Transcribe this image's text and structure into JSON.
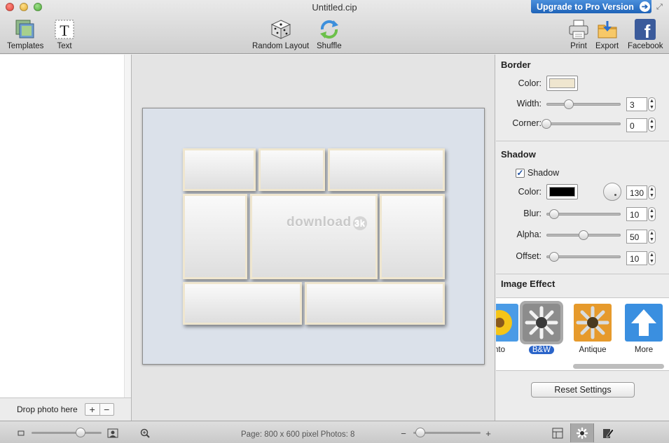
{
  "window": {
    "title": "Untitled.cip",
    "upgrade_label": "Upgrade to Pro Version"
  },
  "toolbar": {
    "templates_label": "Templates",
    "text_label": "Text",
    "random_layout_label": "Random Layout",
    "shuffle_label": "Shuffle",
    "print_label": "Print",
    "export_label": "Export",
    "facebook_label": "Facebook"
  },
  "sidebar": {
    "drop_label": "Drop photo here",
    "add_label": "+",
    "remove_label": "−"
  },
  "canvas": {
    "watermark_text": "download",
    "watermark_badge": "3k",
    "page_color": "#dbe1ea",
    "cell_border_color": "#efe6cf",
    "photo_cells": 8
  },
  "panel": {
    "border": {
      "title": "Border",
      "color_label": "Color:",
      "color_value": "#efe6cf",
      "width_label": "Width:",
      "width_value": "3",
      "width_level": 0.3,
      "corner_label": "Corner:",
      "corner_value": "0",
      "corner_level": 0.0
    },
    "shadow": {
      "title": "Shadow",
      "checkbox_label": "Shadow",
      "checked": true,
      "color_label": "Color:",
      "color_value": "#000000",
      "angle_value": "130",
      "blur_label": "Blur:",
      "blur_value": "10",
      "blur_level": 0.1,
      "alpha_label": "Alpha:",
      "alpha_value": "50",
      "alpha_level": 0.5,
      "offset_label": "Offset:",
      "offset_value": "10",
      "offset_level": 0.1
    },
    "image_effect": {
      "title": "Image Effect",
      "items": [
        {
          "label": "nto",
          "icon": "flower-auto-icon",
          "selected": false
        },
        {
          "label": "B&W",
          "icon": "flower-bw-icon",
          "selected": true
        },
        {
          "label": "Antique",
          "icon": "flower-antique-icon",
          "selected": false
        },
        {
          "label": "More",
          "icon": "arrow-up-icon",
          "selected": false
        }
      ]
    },
    "reset_label": "Reset Settings"
  },
  "statusbar": {
    "status_text": "Page: 800 x 600 pixel Photos: 8",
    "thumb_size_level": 0.7,
    "zoom_level": 0.1
  }
}
